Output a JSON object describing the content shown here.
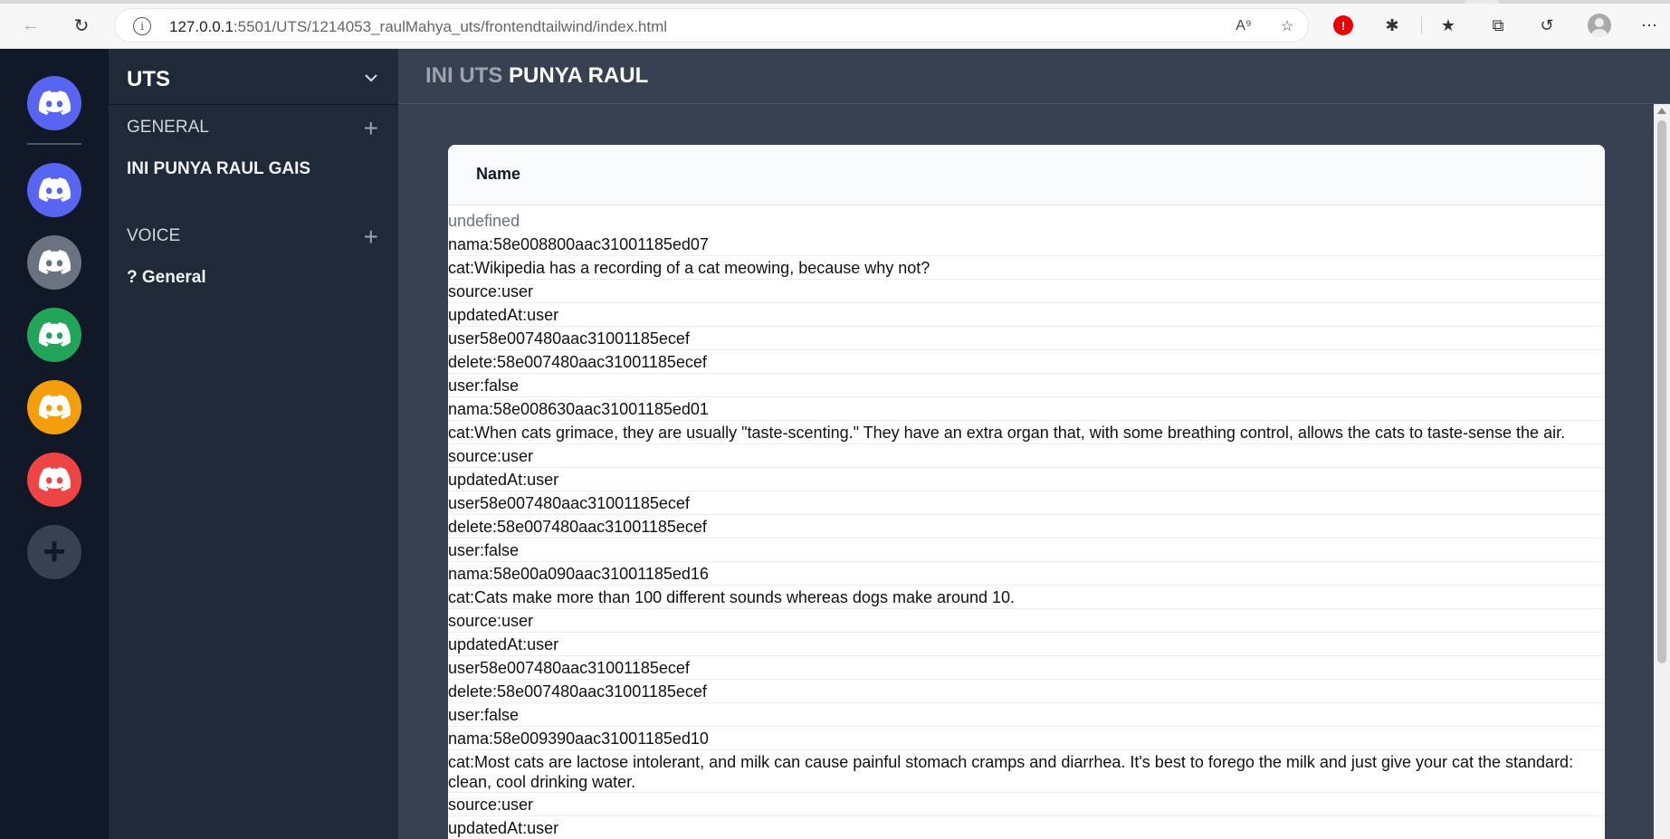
{
  "browser": {
    "url_host": "127.0.0.1",
    "url_rest": ":5501/UTS/1214053_raulMahya_uts/frontendtailwind/index.html"
  },
  "servers": {
    "colors": [
      "#5865f2",
      "#5865f2",
      "#6b7280",
      "#22a559",
      "#f59e0b",
      "#ef4444",
      "#374151"
    ],
    "add_label": "+"
  },
  "channels": {
    "title": "UTS",
    "general_label": "GENERAL",
    "general_item": "INI PUNYA RAUL GAIS",
    "voice_label": "VOICE",
    "voice_item": "? General"
  },
  "main": {
    "title_muted": "INI UTS",
    "title_strong": "PUNYA RAUL"
  },
  "table": {
    "header": "Name",
    "rows": [
      "undefined",
      "nama:58e008800aac31001185ed07",
      "cat:Wikipedia has a recording of a cat meowing, because why not?",
      "source:user",
      "updatedAt:user",
      "user58e007480aac31001185ecef",
      "delete:58e007480aac31001185ecef",
      "user:false",
      "nama:58e008630aac31001185ed01",
      "cat:When cats grimace, they are usually \"taste-scenting.\" They have an extra organ that, with some breathing control, allows the cats to taste-sense the air.",
      "source:user",
      "updatedAt:user",
      "user58e007480aac31001185ecef",
      "delete:58e007480aac31001185ecef",
      "user:false",
      "nama:58e00a090aac31001185ed16",
      "cat:Cats make more than 100 different sounds whereas dogs make around 10.",
      "source:user",
      "updatedAt:user",
      "user58e007480aac31001185ecef",
      "delete:58e007480aac31001185ecef",
      "user:false",
      "nama:58e009390aac31001185ed10",
      "cat:Most cats are lactose intolerant, and milk can cause painful stomach cramps and diarrhea. It's best to forego the milk and just give your cat the standard: clean, cool drinking water.",
      "source:user",
      "updatedAt:user"
    ]
  }
}
